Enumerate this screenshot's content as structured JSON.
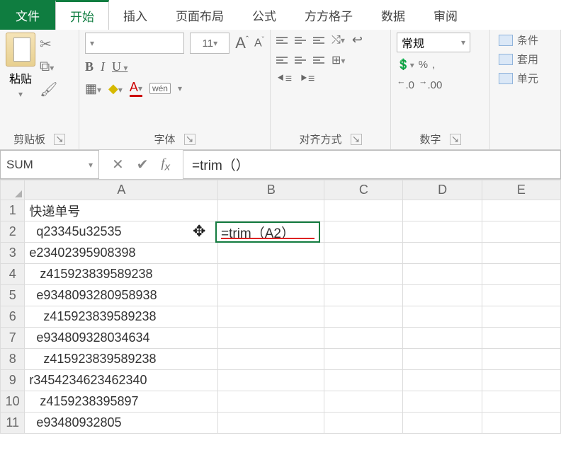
{
  "tabs": {
    "file": "文件",
    "home": "开始",
    "insert": "插入",
    "layout": "页面布局",
    "formulas": "公式",
    "ffgz": "方方格子",
    "data": "数据",
    "review": "审阅"
  },
  "ribbon": {
    "clipboard": {
      "paste": "粘贴",
      "label": "剪贴板"
    },
    "font": {
      "size": "11",
      "grow": "A",
      "shrink": "A",
      "ruby": "wén",
      "label": "字体"
    },
    "align": {
      "label": "对齐方式"
    },
    "number": {
      "format": "常规",
      "pct": "%",
      "comma": ",",
      "inc": ".0",
      "dec": ".00",
      "label": "数字"
    },
    "cond": {
      "cf": "条件",
      "tbl": "套用",
      "cell": "单元"
    }
  },
  "namebox": "SUM",
  "formula": "=trim（）",
  "columns": {
    "A": "A",
    "B": "B",
    "C": "C",
    "D": "D",
    "E": "E"
  },
  "rows": {
    "1": {
      "n": "1",
      "A": "快递单号"
    },
    "2": {
      "n": "2",
      "A": "  q23345u32535"
    },
    "3": {
      "n": "3",
      "A": "e23402395908398"
    },
    "4": {
      "n": "4",
      "A": "   z415923839589238"
    },
    "5": {
      "n": "5",
      "A": "  e9348093280958938"
    },
    "6": {
      "n": "6",
      "A": "    z415923839589238"
    },
    "7": {
      "n": "7",
      "A": "  e934809328034634"
    },
    "8": {
      "n": "8",
      "A": "    z415923839589238"
    },
    "9": {
      "n": "9",
      "A": "r3454234623462340"
    },
    "10": {
      "n": "10",
      "A": "   z4159238395897"
    },
    "11": {
      "n": "11",
      "A": "  e93480932805"
    }
  },
  "active_cell": {
    "value": "=trim（A2）"
  }
}
